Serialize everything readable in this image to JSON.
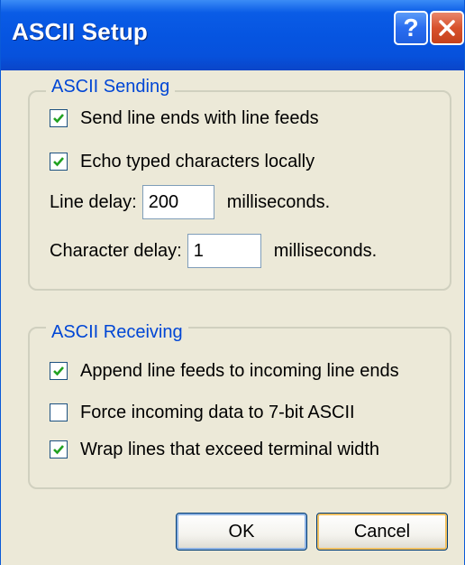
{
  "window": {
    "title": "ASCII Setup"
  },
  "titlebar": {
    "help_label": "?",
    "close_icon": "close-icon"
  },
  "sending": {
    "legend": "ASCII Sending",
    "send_line_ends": {
      "label": "Send line ends with line feeds",
      "checked": true
    },
    "echo_typed": {
      "label": "Echo typed characters locally",
      "checked": true
    },
    "line_delay": {
      "label": "Line delay:",
      "value": "200",
      "unit": "milliseconds."
    },
    "char_delay": {
      "label": "Character delay:",
      "value": "1",
      "unit": "milliseconds."
    }
  },
  "receiving": {
    "legend": "ASCII Receiving",
    "append_line_feeds": {
      "label": "Append line feeds to incoming line ends",
      "checked": true
    },
    "force_7bit": {
      "label": "Force incoming data to 7-bit ASCII",
      "checked": false
    },
    "wrap_lines": {
      "label": "Wrap lines that exceed terminal width",
      "checked": true
    }
  },
  "buttons": {
    "ok": "OK",
    "cancel": "Cancel"
  },
  "colors": {
    "titlebar": "#0655e1",
    "legend": "#0046d5",
    "check": "#21a121",
    "face": "#ece9d8"
  }
}
